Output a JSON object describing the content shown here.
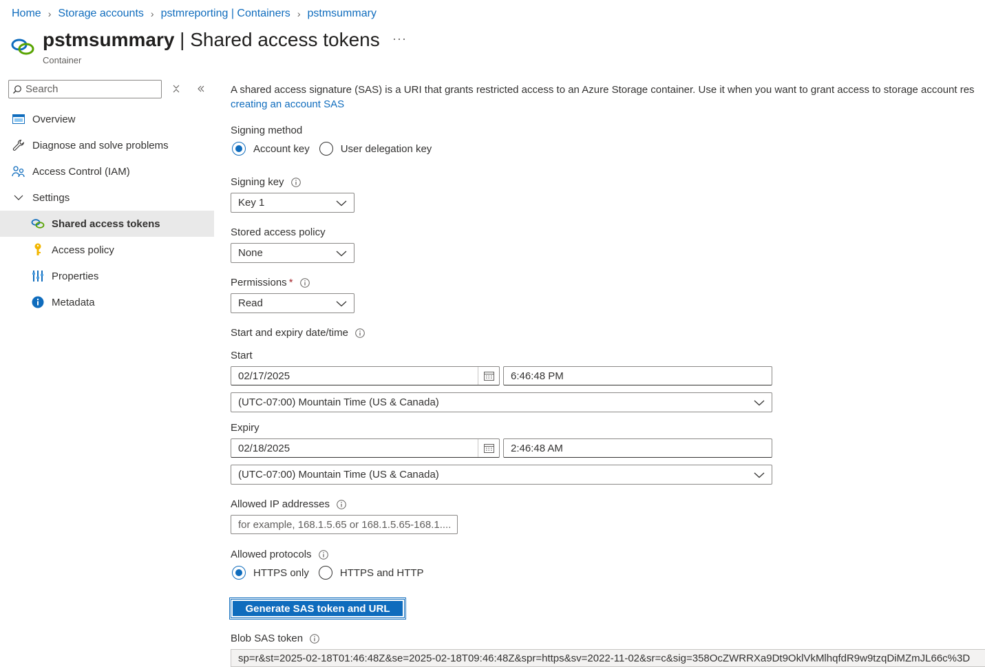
{
  "breadcrumb": {
    "home": "Home",
    "storage_accounts": "Storage accounts",
    "account_containers": "pstmreporting | Containers",
    "container": "pstmsummary"
  },
  "header": {
    "resource_name": "pstmsummary",
    "separator": " | ",
    "blade_title": "Shared access tokens",
    "more": "···",
    "subtitle": "Container"
  },
  "sidebar": {
    "search_placeholder": "Search",
    "items": [
      {
        "label": "Overview",
        "icon": "overview-icon"
      },
      {
        "label": "Diagnose and solve problems",
        "icon": "wrench-icon"
      },
      {
        "label": "Access Control (IAM)",
        "icon": "people-icon"
      },
      {
        "label": "Settings",
        "icon": "chevron-down-icon"
      },
      {
        "label": "Shared access tokens",
        "icon": "link-icon",
        "active": true
      },
      {
        "label": "Access policy",
        "icon": "key-icon"
      },
      {
        "label": "Properties",
        "icon": "properties-icon"
      },
      {
        "label": "Metadata",
        "icon": "info-icon"
      }
    ]
  },
  "main": {
    "description_text": "A shared access signature (SAS) is a URI that grants restricted access to an Azure Storage container. Use it when you want to grant access to storage account res",
    "description_link": "creating an account SAS",
    "signing_method": {
      "label": "Signing method",
      "options": [
        "Account key",
        "User delegation key"
      ],
      "selected": "Account key"
    },
    "signing_key": {
      "label": "Signing key",
      "value": "Key 1"
    },
    "stored_access_policy": {
      "label": "Stored access policy",
      "value": "None"
    },
    "permissions": {
      "label": "Permissions",
      "required_mark": "*",
      "value": "Read"
    },
    "start_expiry": {
      "label": "Start and expiry date/time"
    },
    "start": {
      "label": "Start",
      "date": "02/17/2025",
      "time": "6:46:48 PM",
      "timezone": "(UTC-07:00) Mountain Time (US & Canada)"
    },
    "expiry": {
      "label": "Expiry",
      "date": "02/18/2025",
      "time": "2:46:48 AM",
      "timezone": "(UTC-07:00) Mountain Time (US & Canada)"
    },
    "allowed_ip": {
      "label": "Allowed IP addresses",
      "placeholder": "for example, 168.1.5.65 or 168.1.5.65-168.1...."
    },
    "allowed_protocols": {
      "label": "Allowed protocols",
      "options": [
        "HTTPS only",
        "HTTPS and HTTP"
      ],
      "selected": "HTTPS only"
    },
    "generate_button": "Generate SAS token and URL",
    "blob_sas_token": {
      "label": "Blob SAS token",
      "value": "sp=r&st=2025-02-18T01:46:48Z&se=2025-02-18T09:46:48Z&spr=https&sv=2022-11-02&sr=c&sig=358OcZWRRXa9Dt9OklVkMlhqfdR9w9tzqDiMZmJL66c%3D"
    }
  },
  "colors": {
    "accent": "#0f6cbd",
    "text": "#323130",
    "required": "#a4262c",
    "active_nav_bg": "#e9e9e9"
  }
}
